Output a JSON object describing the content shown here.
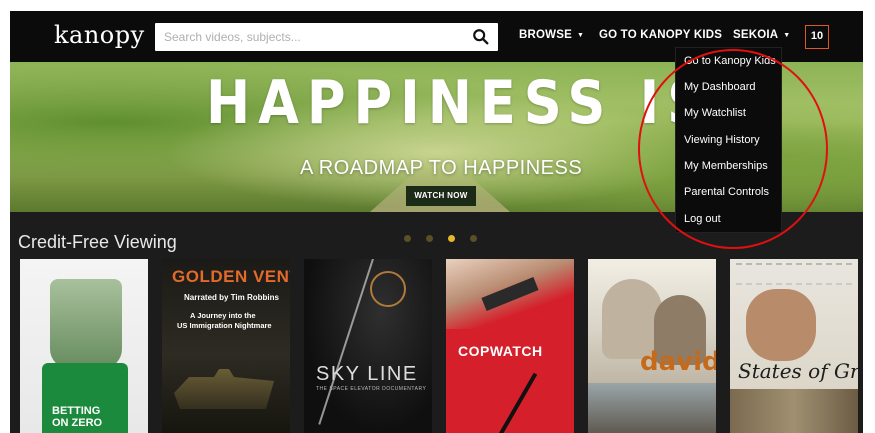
{
  "header": {
    "logo": "kanopy",
    "search_placeholder": "Search videos, subjects...",
    "nav_browse": "BROWSE",
    "nav_kids": "GO TO KANOPY KIDS",
    "nav_user": "SEKOIA",
    "badge_count": "10"
  },
  "hero": {
    "title": "HAPPINESS IS",
    "subtitle": "A ROADMAP TO HAPPINESS",
    "cta": "WATCH NOW"
  },
  "section": {
    "title": "Credit-Free Viewing",
    "carousel_active_index": 3,
    "carousel_count": 4
  },
  "posters": [
    {
      "lines": [
        "BETTING",
        "ON ZERO"
      ]
    },
    {
      "lines": [
        "GOLDEN VENTURE",
        "Narrated by Tim Robbins",
        "A Journey into the",
        "US Immigration Nightmare"
      ]
    },
    {
      "lines": [
        "SKY LINE",
        "THE SPACE ELEVATOR DOCUMENTARY"
      ]
    },
    {
      "lines": [
        "COPWATCH"
      ]
    },
    {
      "lines": [
        "david"
      ]
    },
    {
      "lines": [
        "States of Grace"
      ]
    }
  ],
  "dropdown": {
    "items": [
      "Go to Kanopy Kids",
      "My Dashboard",
      "My Watchlist",
      "Viewing History",
      "My Memberships",
      "Parental Controls",
      "Log out"
    ]
  },
  "colors": {
    "accent_orange": "#e0552a",
    "carousel_active": "#e6b92d",
    "annotation_circle": "#e0100f"
  }
}
